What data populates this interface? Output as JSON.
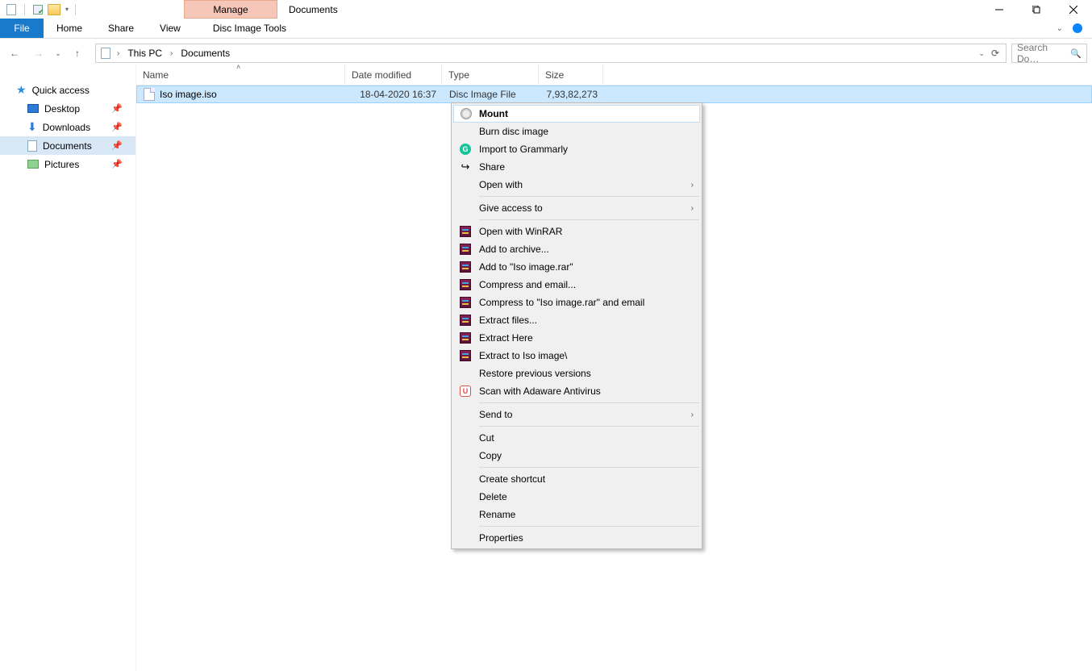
{
  "title": "Documents",
  "manage_tab": "Manage",
  "ribbon": {
    "file": "File",
    "home": "Home",
    "share": "Share",
    "view": "View",
    "contextual": "Disc Image Tools"
  },
  "breadcrumb": {
    "root": "This PC",
    "current": "Documents"
  },
  "search_placeholder": "Search Do…",
  "sidebar": {
    "quick_access": "Quick access",
    "items": [
      {
        "label": "Desktop"
      },
      {
        "label": "Downloads"
      },
      {
        "label": "Documents"
      },
      {
        "label": "Pictures"
      }
    ]
  },
  "columns": {
    "name": "Name",
    "date": "Date modified",
    "type": "Type",
    "size": "Size"
  },
  "file": {
    "name": "Iso image.iso",
    "date": "18-04-2020 16:37",
    "type": "Disc Image File",
    "size": "7,93,82,273"
  },
  "context_menu": {
    "mount": "Mount",
    "burn": "Burn disc image",
    "grammarly": "Import to Grammarly",
    "share": "Share",
    "open_with": "Open with",
    "give_access": "Give access to",
    "open_winrar": "Open with WinRAR",
    "add_archive": "Add to archive...",
    "add_rar": "Add to \"Iso image.rar\"",
    "compress_email": "Compress and email...",
    "compress_rar_email": "Compress to \"Iso image.rar\" and email",
    "extract_files": "Extract files...",
    "extract_here": "Extract Here",
    "extract_to": "Extract to Iso image\\",
    "restore": "Restore previous versions",
    "scan": "Scan with Adaware Antivirus",
    "send_to": "Send to",
    "cut": "Cut",
    "copy": "Copy",
    "shortcut": "Create shortcut",
    "delete": "Delete",
    "rename": "Rename",
    "properties": "Properties"
  }
}
